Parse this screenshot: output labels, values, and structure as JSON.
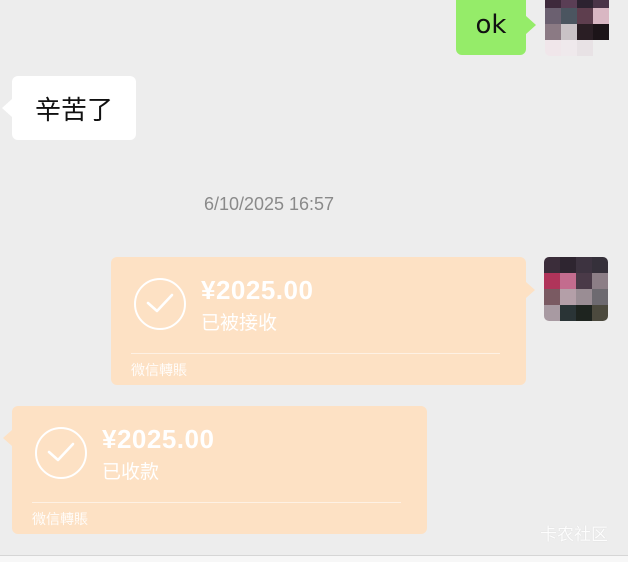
{
  "messages": {
    "sent_text": "ok",
    "received_text": "辛苦了",
    "timestamp": "6/10/2025 16:57"
  },
  "transfer_sent": {
    "amount": "¥2025.00",
    "status": "已被接收",
    "label": "微信轉賬"
  },
  "transfer_received": {
    "amount": "¥2025.00",
    "status": "已收款",
    "label": "微信轉賬"
  },
  "watermark": "卡农社区",
  "colors": {
    "background": "#ededed",
    "sent_bubble": "#95ec69",
    "received_bubble": "#ffffff",
    "transfer_card": "#fde1c4"
  }
}
